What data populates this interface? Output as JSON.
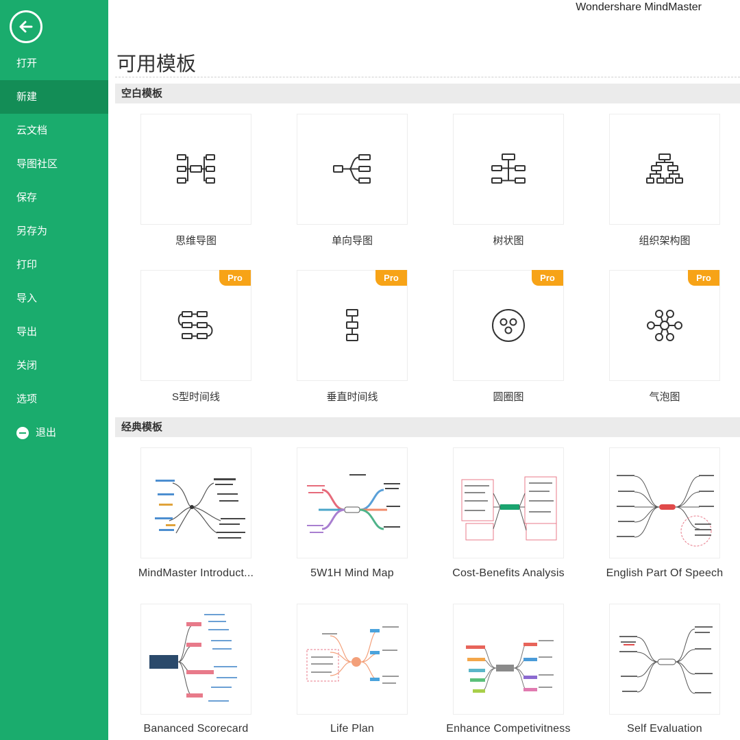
{
  "app": {
    "title": "Wondershare MindMaster"
  },
  "sidebar": {
    "items": [
      {
        "label": "打开",
        "active": false
      },
      {
        "label": "新建",
        "active": true
      },
      {
        "label": "云文档",
        "active": false
      },
      {
        "label": "导图社区",
        "active": false
      },
      {
        "label": "保存",
        "active": false
      },
      {
        "label": "另存为",
        "active": false
      },
      {
        "label": "打印",
        "active": false
      },
      {
        "label": "导入",
        "active": false
      },
      {
        "label": "导出",
        "active": false
      },
      {
        "label": "关闭",
        "active": false
      },
      {
        "label": "选项",
        "active": false
      }
    ],
    "exit_label": "退出"
  },
  "main": {
    "title": "可用模板",
    "blank_section": {
      "label": "空白模板",
      "templates": [
        {
          "label": "思维导图",
          "icon": "mind-map-icon",
          "pro": false
        },
        {
          "label": "单向导图",
          "icon": "right-map-icon",
          "pro": false
        },
        {
          "label": "树状图",
          "icon": "tree-map-icon",
          "pro": false
        },
        {
          "label": "组织架构图",
          "icon": "org-chart-icon",
          "pro": false
        },
        {
          "label": "S型时间线",
          "icon": "s-timeline-icon",
          "pro": true
        },
        {
          "label": "垂直时间线",
          "icon": "vertical-timeline-icon",
          "pro": true
        },
        {
          "label": "圆圈图",
          "icon": "circle-map-icon",
          "pro": true
        },
        {
          "label": "气泡图",
          "icon": "bubble-map-icon",
          "pro": true
        }
      ]
    },
    "pro_badge": "Pro",
    "classic_section": {
      "label": "经典模板",
      "templates": [
        {
          "label": "MindMaster Introduct..."
        },
        {
          "label": "5W1H Mind Map"
        },
        {
          "label": "Cost-Benefits Analysis"
        },
        {
          "label": "English Part Of Speech"
        },
        {
          "label": "Bananced Scorecard"
        },
        {
          "label": "Life Plan"
        },
        {
          "label": "Enhance Competivitness"
        },
        {
          "label": "Self Evaluation"
        }
      ]
    }
  },
  "colors": {
    "sidebar": "#1aac6d",
    "sidebar_active": "#138d56",
    "pro": "#f7a317"
  }
}
